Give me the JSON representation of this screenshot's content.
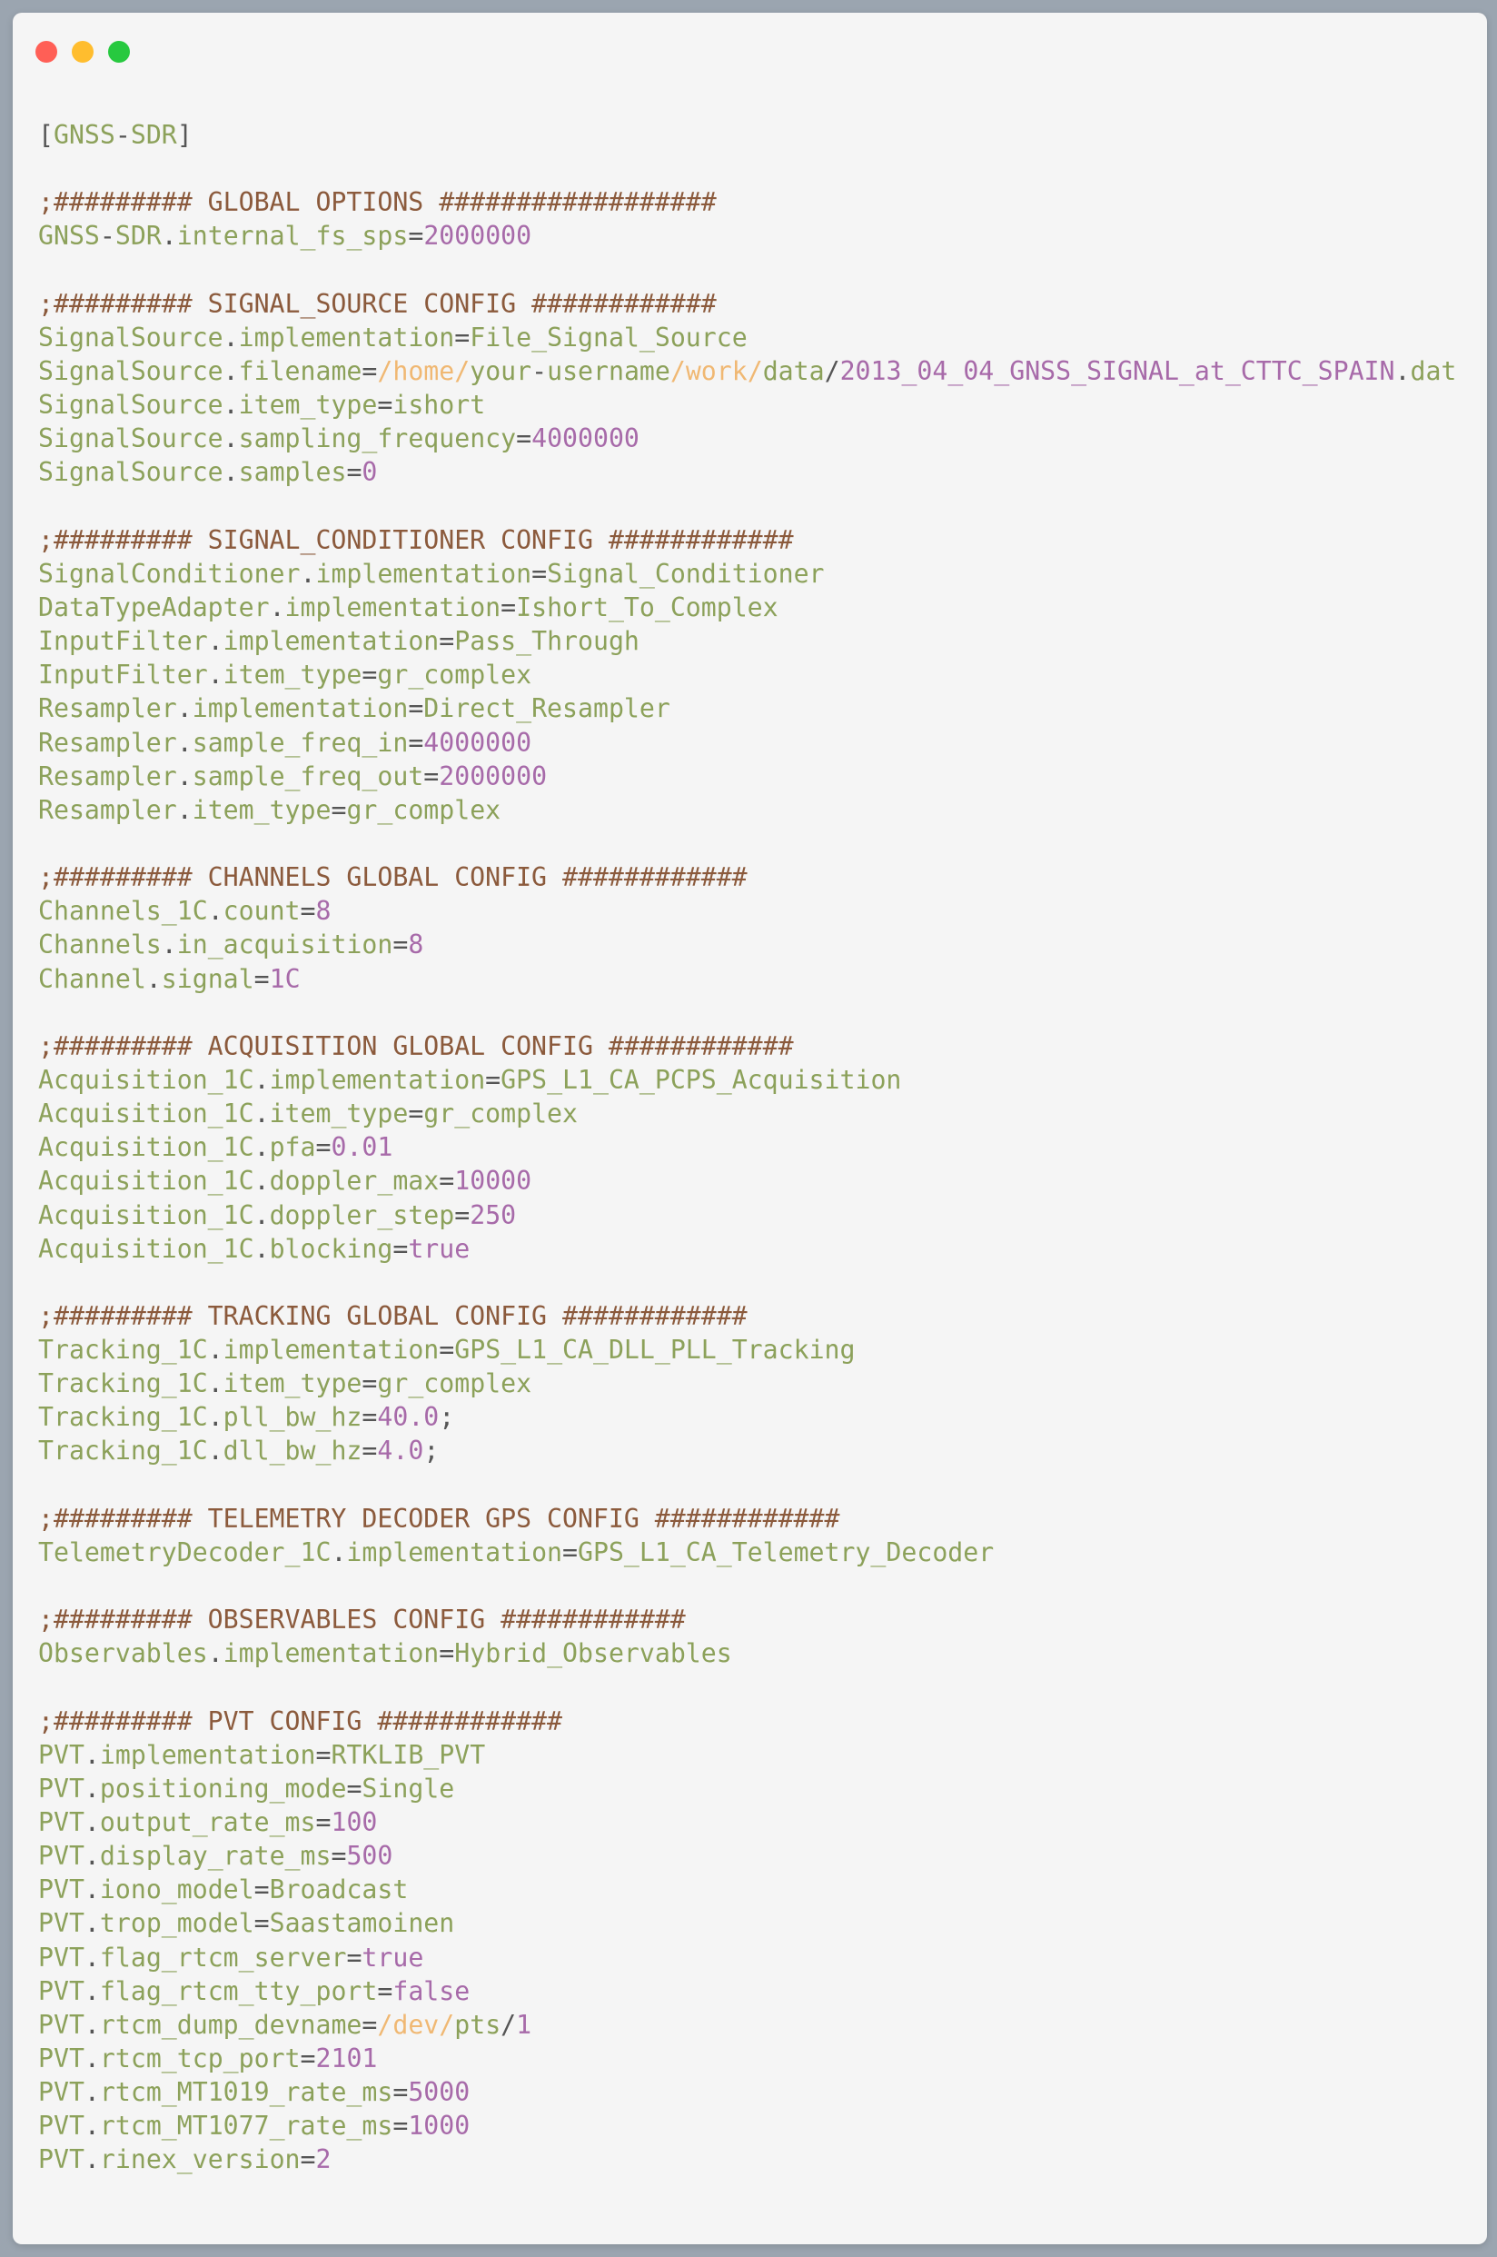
{
  "window": {
    "controls": [
      "close",
      "minimize",
      "maximize"
    ]
  },
  "lines": [
    [
      [
        "p",
        "["
      ],
      [
        "k",
        "GNSS"
      ],
      [
        "p",
        "-"
      ],
      [
        "k",
        "SDR"
      ],
      [
        "p",
        "]"
      ]
    ],
    [],
    [
      [
        "c",
        ";######### GLOBAL OPTIONS ##################"
      ]
    ],
    [
      [
        "k",
        "GNSS"
      ],
      [
        "p",
        "-"
      ],
      [
        "k",
        "SDR"
      ],
      [
        "p",
        "."
      ],
      [
        "k",
        "internal_fs_sps"
      ],
      [
        "p",
        "="
      ],
      [
        "n",
        "2000000"
      ]
    ],
    [],
    [
      [
        "c",
        ";######### SIGNAL_SOURCE CONFIG ############"
      ]
    ],
    [
      [
        "k",
        "SignalSource"
      ],
      [
        "p",
        "."
      ],
      [
        "k",
        "implementation"
      ],
      [
        "p",
        "="
      ],
      [
        "k",
        "File_Signal_Source"
      ]
    ],
    [
      [
        "k",
        "SignalSource"
      ],
      [
        "p",
        "."
      ],
      [
        "k",
        "filename"
      ],
      [
        "p",
        "="
      ],
      [
        "s",
        "/home/"
      ],
      [
        "k",
        "your"
      ],
      [
        "p",
        "-"
      ],
      [
        "k",
        "username"
      ],
      [
        "s",
        "/work/"
      ],
      [
        "k",
        "data"
      ],
      [
        "p",
        "/"
      ],
      [
        "n",
        "2013_04_04_GNSS_SIGNAL_at_CTTC_SPAIN"
      ],
      [
        "p",
        "."
      ],
      [
        "k",
        "dat"
      ]
    ],
    [
      [
        "k",
        "SignalSource"
      ],
      [
        "p",
        "."
      ],
      [
        "k",
        "item_type"
      ],
      [
        "p",
        "="
      ],
      [
        "k",
        "ishort"
      ]
    ],
    [
      [
        "k",
        "SignalSource"
      ],
      [
        "p",
        "."
      ],
      [
        "k",
        "sampling_frequency"
      ],
      [
        "p",
        "="
      ],
      [
        "n",
        "4000000"
      ]
    ],
    [
      [
        "k",
        "SignalSource"
      ],
      [
        "p",
        "."
      ],
      [
        "k",
        "samples"
      ],
      [
        "p",
        "="
      ],
      [
        "n",
        "0"
      ]
    ],
    [],
    [
      [
        "c",
        ";######### SIGNAL_CONDITIONER CONFIG ############"
      ]
    ],
    [
      [
        "k",
        "SignalConditioner"
      ],
      [
        "p",
        "."
      ],
      [
        "k",
        "implementation"
      ],
      [
        "p",
        "="
      ],
      [
        "k",
        "Signal_Conditioner"
      ]
    ],
    [
      [
        "k",
        "DataTypeAdapter"
      ],
      [
        "p",
        "."
      ],
      [
        "k",
        "implementation"
      ],
      [
        "p",
        "="
      ],
      [
        "k",
        "Ishort_To_Complex"
      ]
    ],
    [
      [
        "k",
        "InputFilter"
      ],
      [
        "p",
        "."
      ],
      [
        "k",
        "implementation"
      ],
      [
        "p",
        "="
      ],
      [
        "k",
        "Pass_Through"
      ]
    ],
    [
      [
        "k",
        "InputFilter"
      ],
      [
        "p",
        "."
      ],
      [
        "k",
        "item_type"
      ],
      [
        "p",
        "="
      ],
      [
        "k",
        "gr_complex"
      ]
    ],
    [
      [
        "k",
        "Resampler"
      ],
      [
        "p",
        "."
      ],
      [
        "k",
        "implementation"
      ],
      [
        "p",
        "="
      ],
      [
        "k",
        "Direct_Resampler"
      ]
    ],
    [
      [
        "k",
        "Resampler"
      ],
      [
        "p",
        "."
      ],
      [
        "k",
        "sample_freq_in"
      ],
      [
        "p",
        "="
      ],
      [
        "n",
        "4000000"
      ]
    ],
    [
      [
        "k",
        "Resampler"
      ],
      [
        "p",
        "."
      ],
      [
        "k",
        "sample_freq_out"
      ],
      [
        "p",
        "="
      ],
      [
        "n",
        "2000000"
      ]
    ],
    [
      [
        "k",
        "Resampler"
      ],
      [
        "p",
        "."
      ],
      [
        "k",
        "item_type"
      ],
      [
        "p",
        "="
      ],
      [
        "k",
        "gr_complex"
      ]
    ],
    [],
    [
      [
        "c",
        ";######### CHANNELS GLOBAL CONFIG ############"
      ]
    ],
    [
      [
        "k",
        "Channels_1C"
      ],
      [
        "p",
        "."
      ],
      [
        "k",
        "count"
      ],
      [
        "p",
        "="
      ],
      [
        "n",
        "8"
      ]
    ],
    [
      [
        "k",
        "Channels"
      ],
      [
        "p",
        "."
      ],
      [
        "k",
        "in_acquisition"
      ],
      [
        "p",
        "="
      ],
      [
        "n",
        "8"
      ]
    ],
    [
      [
        "k",
        "Channel"
      ],
      [
        "p",
        "."
      ],
      [
        "k",
        "signal"
      ],
      [
        "p",
        "="
      ],
      [
        "n",
        "1C"
      ]
    ],
    [],
    [
      [
        "c",
        ";######### ACQUISITION GLOBAL CONFIG ############"
      ]
    ],
    [
      [
        "k",
        "Acquisition_1C"
      ],
      [
        "p",
        "."
      ],
      [
        "k",
        "implementation"
      ],
      [
        "p",
        "="
      ],
      [
        "k",
        "GPS_L1_CA_PCPS_Acquisition"
      ]
    ],
    [
      [
        "k",
        "Acquisition_1C"
      ],
      [
        "p",
        "."
      ],
      [
        "k",
        "item_type"
      ],
      [
        "p",
        "="
      ],
      [
        "k",
        "gr_complex"
      ]
    ],
    [
      [
        "k",
        "Acquisition_1C"
      ],
      [
        "p",
        "."
      ],
      [
        "k",
        "pfa"
      ],
      [
        "p",
        "="
      ],
      [
        "n",
        "0.01"
      ]
    ],
    [
      [
        "k",
        "Acquisition_1C"
      ],
      [
        "p",
        "."
      ],
      [
        "k",
        "doppler_max"
      ],
      [
        "p",
        "="
      ],
      [
        "n",
        "10000"
      ]
    ],
    [
      [
        "k",
        "Acquisition_1C"
      ],
      [
        "p",
        "."
      ],
      [
        "k",
        "doppler_step"
      ],
      [
        "p",
        "="
      ],
      [
        "n",
        "250"
      ]
    ],
    [
      [
        "k",
        "Acquisition_1C"
      ],
      [
        "p",
        "."
      ],
      [
        "k",
        "blocking"
      ],
      [
        "p",
        "="
      ],
      [
        "n",
        "true"
      ]
    ],
    [],
    [
      [
        "c",
        ";######### TRACKING GLOBAL CONFIG ############"
      ]
    ],
    [
      [
        "k",
        "Tracking_1C"
      ],
      [
        "p",
        "."
      ],
      [
        "k",
        "implementation"
      ],
      [
        "p",
        "="
      ],
      [
        "k",
        "GPS_L1_CA_DLL_PLL_Tracking"
      ]
    ],
    [
      [
        "k",
        "Tracking_1C"
      ],
      [
        "p",
        "."
      ],
      [
        "k",
        "item_type"
      ],
      [
        "p",
        "="
      ],
      [
        "k",
        "gr_complex"
      ]
    ],
    [
      [
        "k",
        "Tracking_1C"
      ],
      [
        "p",
        "."
      ],
      [
        "k",
        "pll_bw_hz"
      ],
      [
        "p",
        "="
      ],
      [
        "n",
        "40.0"
      ],
      [
        "p",
        ";"
      ]
    ],
    [
      [
        "k",
        "Tracking_1C"
      ],
      [
        "p",
        "."
      ],
      [
        "k",
        "dll_bw_hz"
      ],
      [
        "p",
        "="
      ],
      [
        "n",
        "4.0"
      ],
      [
        "p",
        ";"
      ]
    ],
    [],
    [
      [
        "c",
        ";######### TELEMETRY DECODER GPS CONFIG ############"
      ]
    ],
    [
      [
        "k",
        "TelemetryDecoder_1C"
      ],
      [
        "p",
        "."
      ],
      [
        "k",
        "implementation"
      ],
      [
        "p",
        "="
      ],
      [
        "k",
        "GPS_L1_CA_Telemetry_Decoder"
      ]
    ],
    [],
    [
      [
        "c",
        ";######### OBSERVABLES CONFIG ############"
      ]
    ],
    [
      [
        "k",
        "Observables"
      ],
      [
        "p",
        "."
      ],
      [
        "k",
        "implementation"
      ],
      [
        "p",
        "="
      ],
      [
        "k",
        "Hybrid_Observables"
      ]
    ],
    [],
    [
      [
        "c",
        ";######### PVT CONFIG ############"
      ]
    ],
    [
      [
        "k",
        "PVT"
      ],
      [
        "p",
        "."
      ],
      [
        "k",
        "implementation"
      ],
      [
        "p",
        "="
      ],
      [
        "k",
        "RTKLIB_PVT"
      ]
    ],
    [
      [
        "k",
        "PVT"
      ],
      [
        "p",
        "."
      ],
      [
        "k",
        "positioning_mode"
      ],
      [
        "p",
        "="
      ],
      [
        "k",
        "Single"
      ]
    ],
    [
      [
        "k",
        "PVT"
      ],
      [
        "p",
        "."
      ],
      [
        "k",
        "output_rate_ms"
      ],
      [
        "p",
        "="
      ],
      [
        "n",
        "100"
      ]
    ],
    [
      [
        "k",
        "PVT"
      ],
      [
        "p",
        "."
      ],
      [
        "k",
        "display_rate_ms"
      ],
      [
        "p",
        "="
      ],
      [
        "n",
        "500"
      ]
    ],
    [
      [
        "k",
        "PVT"
      ],
      [
        "p",
        "."
      ],
      [
        "k",
        "iono_model"
      ],
      [
        "p",
        "="
      ],
      [
        "k",
        "Broadcast"
      ]
    ],
    [
      [
        "k",
        "PVT"
      ],
      [
        "p",
        "."
      ],
      [
        "k",
        "trop_model"
      ],
      [
        "p",
        "="
      ],
      [
        "k",
        "Saastamoinen"
      ]
    ],
    [
      [
        "k",
        "PVT"
      ],
      [
        "p",
        "."
      ],
      [
        "k",
        "flag_rtcm_server"
      ],
      [
        "p",
        "="
      ],
      [
        "n",
        "true"
      ]
    ],
    [
      [
        "k",
        "PVT"
      ],
      [
        "p",
        "."
      ],
      [
        "k",
        "flag_rtcm_tty_port"
      ],
      [
        "p",
        "="
      ],
      [
        "n",
        "false"
      ]
    ],
    [
      [
        "k",
        "PVT"
      ],
      [
        "p",
        "."
      ],
      [
        "k",
        "rtcm_dump_devname"
      ],
      [
        "p",
        "="
      ],
      [
        "s",
        "/dev/"
      ],
      [
        "k",
        "pts"
      ],
      [
        "p",
        "/"
      ],
      [
        "n",
        "1"
      ]
    ],
    [
      [
        "k",
        "PVT"
      ],
      [
        "p",
        "."
      ],
      [
        "k",
        "rtcm_tcp_port"
      ],
      [
        "p",
        "="
      ],
      [
        "n",
        "2101"
      ]
    ],
    [
      [
        "k",
        "PVT"
      ],
      [
        "p",
        "."
      ],
      [
        "k",
        "rtcm_MT1019_rate_ms"
      ],
      [
        "p",
        "="
      ],
      [
        "n",
        "5000"
      ]
    ],
    [
      [
        "k",
        "PVT"
      ],
      [
        "p",
        "."
      ],
      [
        "k",
        "rtcm_MT1077_rate_ms"
      ],
      [
        "p",
        "="
      ],
      [
        "n",
        "1000"
      ]
    ],
    [
      [
        "k",
        "PVT"
      ],
      [
        "p",
        "."
      ],
      [
        "k",
        "rinex_version"
      ],
      [
        "p",
        "="
      ],
      [
        "n",
        "2"
      ]
    ]
  ]
}
